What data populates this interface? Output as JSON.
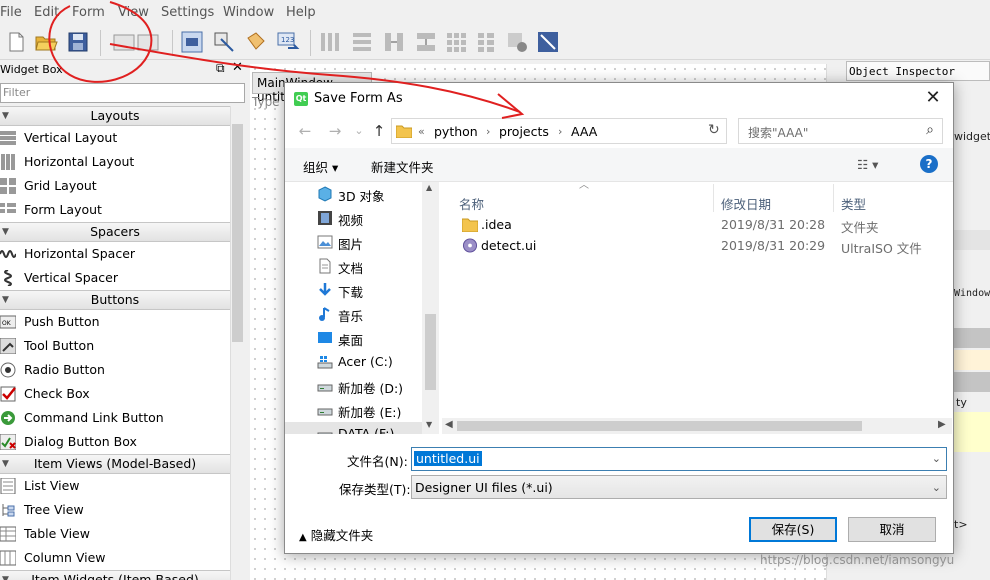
{
  "menubar": {
    "items": [
      "File",
      "Edit",
      "Form",
      "View",
      "Settings",
      "Window",
      "Help"
    ]
  },
  "widget_box": {
    "title": "Widget Box",
    "filter_placeholder": "Filter",
    "categories": [
      {
        "name": "Layouts",
        "items": [
          "Vertical Layout",
          "Horizontal Layout",
          "Grid Layout",
          "Form Layout"
        ]
      },
      {
        "name": "Spacers",
        "items": [
          "Horizontal Spacer",
          "Vertical Spacer"
        ]
      },
      {
        "name": "Buttons",
        "items": [
          "Push Button",
          "Tool Button",
          "Radio Button",
          "Check Box",
          "Command Link Button",
          "Dialog Button Box"
        ]
      },
      {
        "name": "Item Views (Model-Based)",
        "items": [
          "List View",
          "Tree View",
          "Table View",
          "Column View"
        ]
      },
      {
        "name": "Item Widgets (Item-Based)",
        "items": []
      }
    ]
  },
  "canvas": {
    "tab_title": "MainWindow - untitled",
    "subtitle": "Type Here"
  },
  "object_inspector": {
    "title": "Object Inspector",
    "fragments": [
      "widget",
      "Window",
      "ty",
      "t>"
    ]
  },
  "dialog": {
    "title": "Save Form As",
    "path": [
      "python",
      "projects",
      "AAA"
    ],
    "path_prefix": "«",
    "search_placeholder": "搜索\"AAA\"",
    "organize_label": "组织 ▾",
    "new_folder_label": "新建文件夹",
    "nav_items": [
      "3D 对象",
      "视频",
      "图片",
      "文档",
      "下载",
      "音乐",
      "桌面",
      "Acer (C:)",
      "新加卷 (D:)",
      "新加卷 (E:)",
      "DATA (F:)"
    ],
    "columns": {
      "name": "名称",
      "date": "修改日期",
      "type": "类型"
    },
    "files": [
      {
        "name": ".idea",
        "date": "2019/8/31 20:28",
        "type": "文件夹",
        "icon": "folder-icon"
      },
      {
        "name": "detect.ui",
        "date": "2019/8/31 20:29",
        "type": "UltraISO 文件",
        "icon": "disc-icon"
      }
    ],
    "filename_label": "文件名(N):",
    "filename_value": "untitled.ui",
    "filetype_label": "保存类型(T):",
    "filetype_value": "Designer UI files (*.ui)",
    "hide_folders_label": "隐藏文件夹",
    "save_label": "保存(S)",
    "cancel_label": "取消"
  },
  "watermark": "https://blog.csdn.net/iamsongyu",
  "colors": {
    "accent": "#0078d7",
    "annotation": "#e02020",
    "help": "#1a6fc8"
  }
}
